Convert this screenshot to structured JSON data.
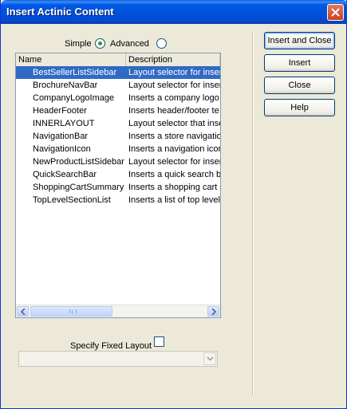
{
  "window": {
    "title": "Insert Actinic Content"
  },
  "mode": {
    "simple_label": "Simple",
    "advanced_label": "Advanced",
    "selected": "simple"
  },
  "list": {
    "columns": [
      "Name",
      "Description"
    ],
    "selected_index": 0,
    "rows": [
      {
        "name": "BestSellerListSidebar",
        "description": "Layout selector for inser"
      },
      {
        "name": "BrochureNavBar",
        "description": "Layout selector for inser"
      },
      {
        "name": "CompanyLogoImage",
        "description": "Inserts a company logo"
      },
      {
        "name": "HeaderFooter",
        "description": "Inserts header/footer te"
      },
      {
        "name": "INNERLAYOUT",
        "description": "Layout selector that inse"
      },
      {
        "name": "NavigationBar",
        "description": "Inserts a store navigatio"
      },
      {
        "name": "NavigationIcon",
        "description": "Inserts a navigation icor"
      },
      {
        "name": "NewProductListSidebar",
        "description": "Layout selector for inser"
      },
      {
        "name": "QuickSearchBar",
        "description": "Inserts a quick search ba"
      },
      {
        "name": "ShoppingCartSummary",
        "description": "Inserts a shopping cart s"
      },
      {
        "name": "TopLevelSectionList",
        "description": "Inserts a list of top level"
      }
    ]
  },
  "fixed_layout": {
    "label": "Specify Fixed Layout",
    "checked": false,
    "value": ""
  },
  "buttons": {
    "insert_close": "Insert and Close",
    "insert": "Insert",
    "close": "Close",
    "help": "Help"
  },
  "icons": {
    "close": "close-x-icon",
    "radio_selected": "radio-dot-icon",
    "scroll_left": "arrow-left-icon",
    "scroll_right": "arrow-right-icon",
    "combo": "chevron-down-icon"
  },
  "colors": {
    "titlebar": "#0054e3",
    "selection": "#316ac5",
    "dialog_bg": "#ece9d8",
    "radio_dot": "#21a121",
    "close_button": "#d9512c"
  }
}
